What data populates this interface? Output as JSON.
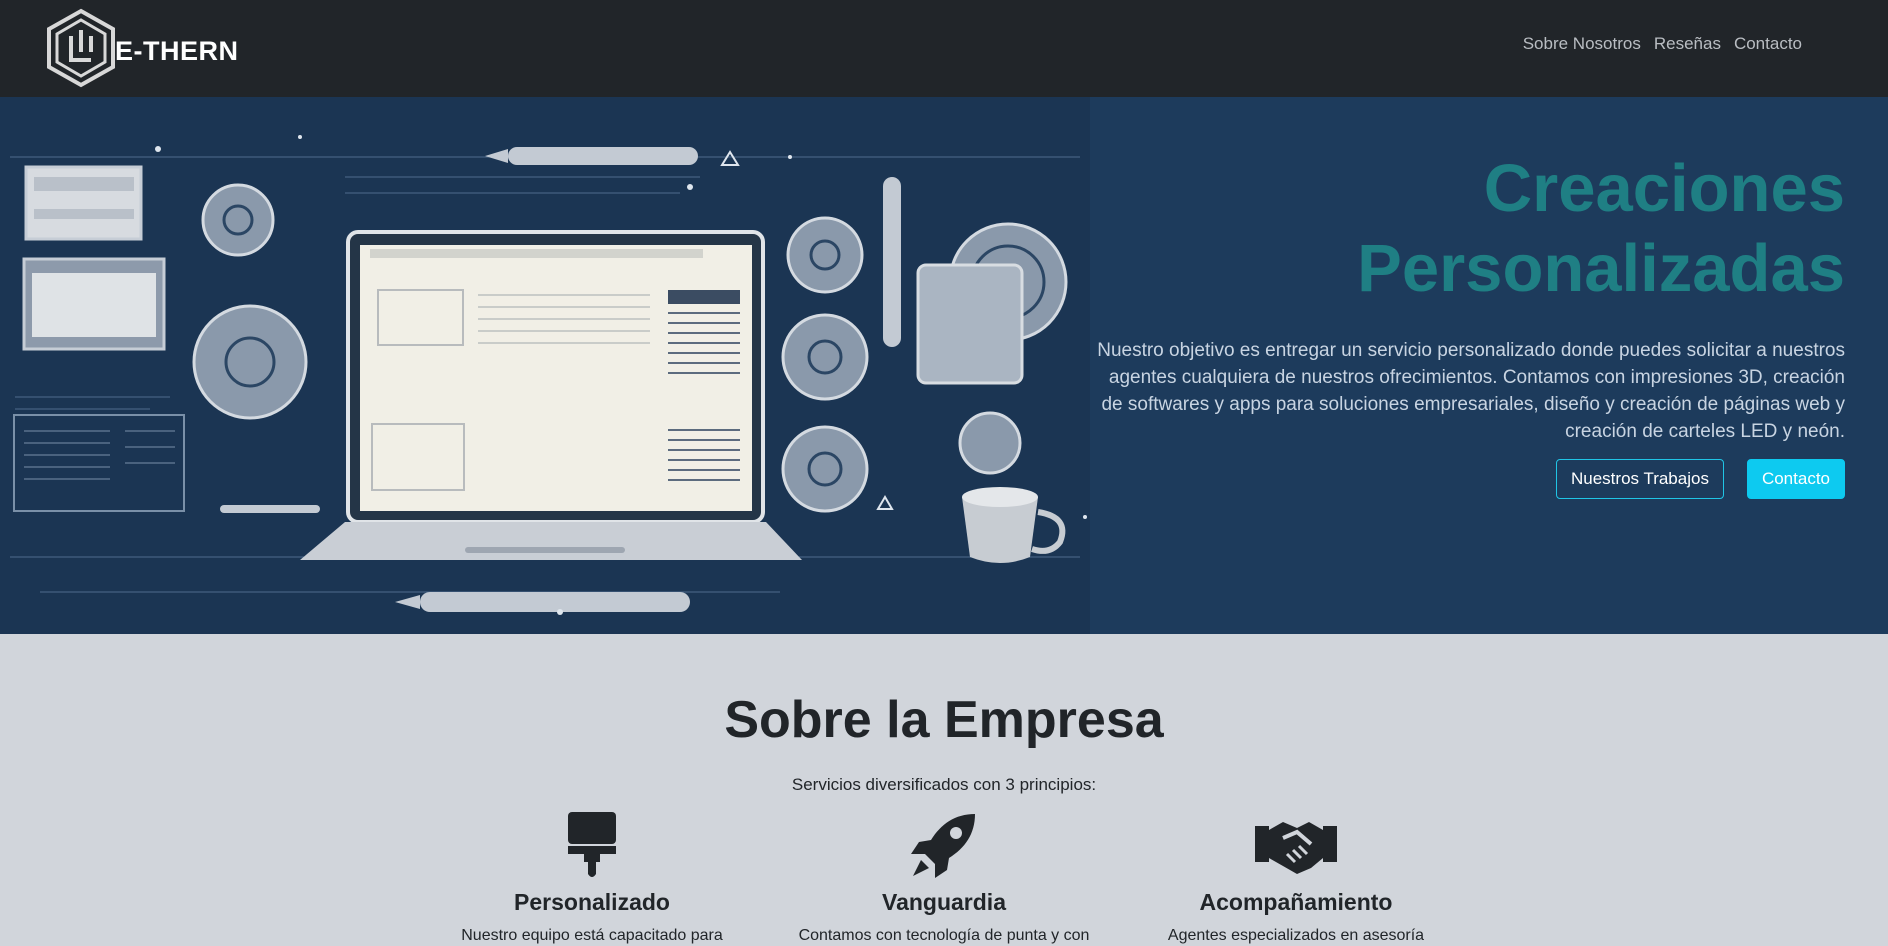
{
  "brand": {
    "name": "E-THERN"
  },
  "nav": {
    "items": [
      "Sobre Nosotros",
      "Reseñas",
      "Contacto"
    ]
  },
  "hero": {
    "title_line1": "Creaciones",
    "title_line2": "Personalizadas",
    "description": "Nuestro objetivo es entregar un servicio personalizado donde puedes solicitar a nuestros agentes cualquiera de nuestros ofrecimientos. Contamos con impresiones 3D, creación de softwares y apps para soluciones empresariales, diseño y creación de páginas web y creación de carteles LED y neón.",
    "buttons": {
      "works": "Nuestros Trabajos",
      "contact": "Contacto"
    }
  },
  "about": {
    "title": "Sobre la Empresa",
    "subtitle": "Servicios diversificados con 3 principios:",
    "features": [
      {
        "icon": "paint-roller-icon",
        "title": "Personalizado",
        "text": "Nuestro equipo está capacitado para"
      },
      {
        "icon": "rocket-icon",
        "title": "Vanguardia",
        "text": "Contamos con tecnología de punta y con"
      },
      {
        "icon": "handshake-icon",
        "title": "Acompañamiento",
        "text": "Agentes especializados en asesoría"
      }
    ]
  },
  "colors": {
    "nav_bg": "#212529",
    "hero_bg": "#1d3b5c",
    "accent_teal": "#1f7f84",
    "accent_cyan": "#0dcaf0",
    "section_bg": "#d1d5db"
  }
}
